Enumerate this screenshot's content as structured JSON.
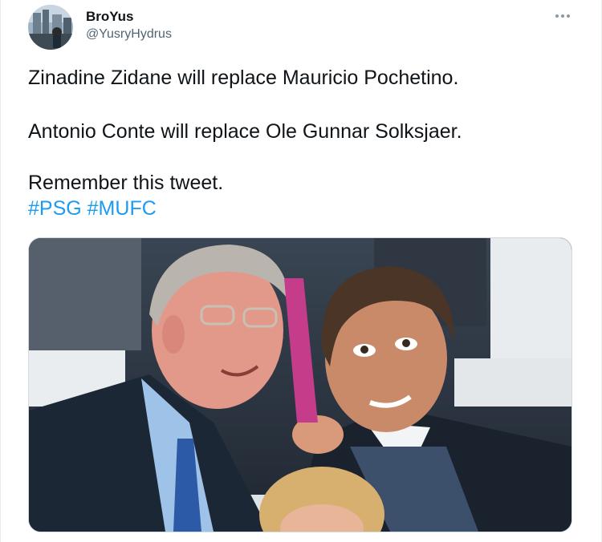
{
  "tweet": {
    "display_name": "BroYus",
    "handle": "@YusryHydrus",
    "lines": [
      "Zinadine Zidane will replace Mauricio Pochetino.",
      "Antonio Conte will replace Ole Gunnar Solksjaer.",
      "Remember this tweet."
    ],
    "hashtags": [
      "#PSG",
      "#MUFC"
    ]
  },
  "colors": {
    "link": "#1d9bf0",
    "text": "#0f1419",
    "muted": "#536471"
  },
  "icons": {
    "more": "more-horizontal-icon"
  }
}
